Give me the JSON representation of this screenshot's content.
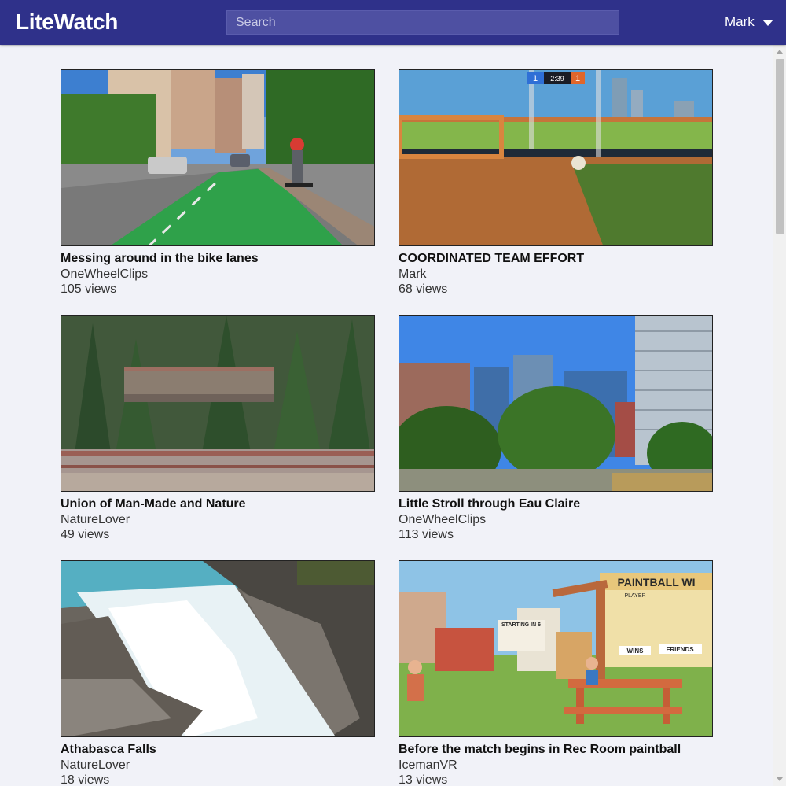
{
  "app": {
    "brand": "LiteWatch"
  },
  "search": {
    "placeholder": "Search",
    "value": ""
  },
  "user": {
    "name": "Mark"
  },
  "videos": [
    {
      "title": "Messing around in the bike lanes",
      "channel": "OneWheelClips",
      "views": "105 views",
      "thumbnail": "city-bike-lane"
    },
    {
      "title": "COORDINATED TEAM EFFORT",
      "channel": "Mark",
      "views": "68 views",
      "thumbnail": "game-arena",
      "score": {
        "left": "1",
        "time": "2:39",
        "right": "1"
      }
    },
    {
      "title": "Union of Man-Made and Nature",
      "channel": "NatureLover",
      "views": "49 views",
      "thumbnail": "forest-bridge"
    },
    {
      "title": "Little Stroll through Eau Claire",
      "channel": "OneWheelClips",
      "views": "113 views",
      "thumbnail": "city-towers-park"
    },
    {
      "title": "Athabasca Falls",
      "channel": "NatureLover",
      "views": "18 views",
      "thumbnail": "waterfall"
    },
    {
      "title": "Before the match begins in Rec Room paintball",
      "channel": "IcemanVR",
      "views": "13 views",
      "thumbnail": "vr-paintball",
      "signs": {
        "board": "PAINTBALL WI",
        "sub": "PLAYER",
        "starting": "STARTING IN 6",
        "wins": "WINS",
        "friends": "FRIENDS"
      }
    }
  ]
}
